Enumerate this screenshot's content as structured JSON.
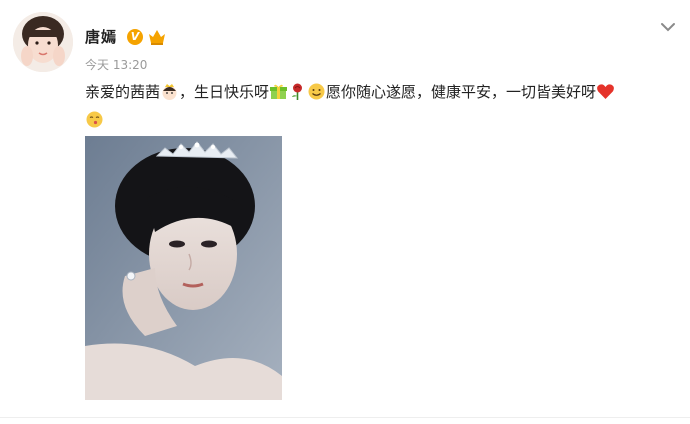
{
  "post": {
    "author": {
      "name": "唐嫣",
      "verified_badge": "V",
      "vip_badge_icon": "vip-crown-icon"
    },
    "time": "今天 13:20",
    "content": {
      "part1": "亲爱的茜茜",
      "part2": "，生日快乐呀",
      "part3": "愿你随心遂愿，健康平安，一切皆美好呀"
    },
    "emojis": [
      "princess-emoji-icon",
      "gift-emoji-icon",
      "rose-emoji-icon",
      "smiley-emoji-icon",
      "heart-emoji-icon",
      "kiss-emoji-icon"
    ],
    "photo": {
      "subject": "portrait-with-tiara"
    },
    "menu_icon": "chevron-down-icon"
  },
  "colors": {
    "badge_orange": "#f5a300",
    "heart_red": "#e5332a",
    "text": "#222222",
    "muted": "#9a9a9a"
  }
}
